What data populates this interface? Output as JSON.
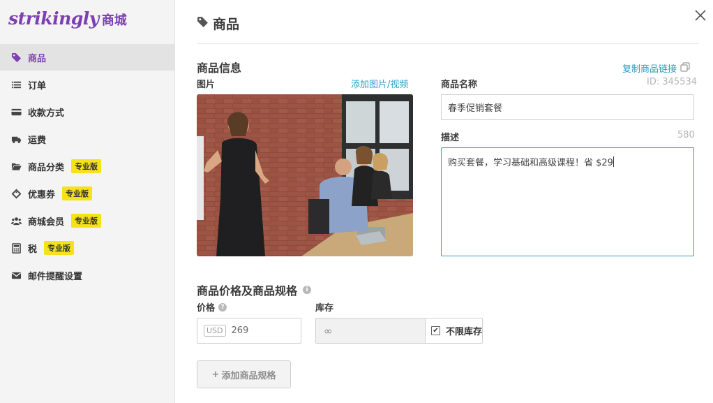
{
  "logo": {
    "brand": "strikingly",
    "suffix": "商城"
  },
  "sidebar": {
    "items": [
      {
        "label": "商品",
        "icon": "tag-icon",
        "active": true,
        "badge": ""
      },
      {
        "label": "订单",
        "icon": "list-icon",
        "active": false,
        "badge": ""
      },
      {
        "label": "收款方式",
        "icon": "credit-card-icon",
        "active": false,
        "badge": ""
      },
      {
        "label": "运费",
        "icon": "truck-icon",
        "active": false,
        "badge": ""
      },
      {
        "label": "商品分类",
        "icon": "folder-icon",
        "active": false,
        "badge": "专业版"
      },
      {
        "label": "优惠券",
        "icon": "ticket-icon",
        "active": false,
        "badge": "专业版"
      },
      {
        "label": "商城会员",
        "icon": "users-icon",
        "active": false,
        "badge": "专业版"
      },
      {
        "label": "税",
        "icon": "calculator-icon",
        "active": false,
        "badge": "专业版"
      },
      {
        "label": "邮件提醒设置",
        "icon": "envelope-icon",
        "active": false,
        "badge": ""
      }
    ]
  },
  "header": {
    "title": "商品"
  },
  "product_info": {
    "section_title": "商品信息",
    "copy_link": "复制商品链接",
    "image_label": "图片",
    "add_media": "添加图片/视频",
    "name_label": "商品名称",
    "id_text": "ID: 345534",
    "name_value": "春季促销套餐",
    "desc_label": "描述",
    "desc_remaining": "580",
    "desc_value": "购买套餐，学习基础和高级课程！省 $29"
  },
  "pricing": {
    "section_title": "商品价格及商品规格",
    "price_label": "价格",
    "currency": "USD",
    "price_value": "269",
    "stock_label": "库存",
    "stock_value": "∞",
    "unlimited_label": "不限库存",
    "unlimited_checked": true,
    "add_variant": "添加商品规格"
  },
  "colors": {
    "accent": "#7d3fb2",
    "link": "#2aa0c8",
    "badge": "#f6e11a"
  }
}
